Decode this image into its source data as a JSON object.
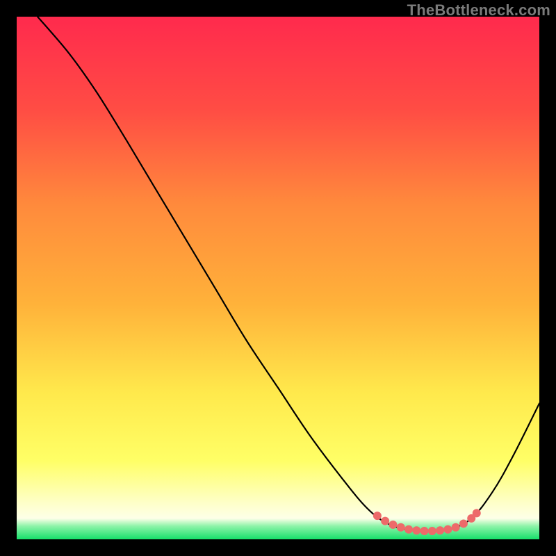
{
  "watermark": "TheBottleneck.com",
  "colors": {
    "frame_bg": "#000000",
    "watermark": "#7a7a7a",
    "curve": "#000000",
    "marker": "#ed6a6a",
    "grad_top": "#ff2a4d",
    "grad_mid1": "#ff6a3c",
    "grad_mid2": "#ffb23a",
    "grad_mid3": "#ffe34a",
    "grad_mid4": "#ffff66",
    "grad_bottom_yellow": "#fdffd0",
    "grad_bottom_green": "#16e06a"
  },
  "chart_data": {
    "type": "line",
    "title": "",
    "xlabel": "",
    "ylabel": "",
    "xlim": [
      0,
      100
    ],
    "ylim": [
      0,
      100
    ],
    "grid": false,
    "curve": [
      {
        "x": 4,
        "y": 100
      },
      {
        "x": 10,
        "y": 93
      },
      {
        "x": 15,
        "y": 86
      },
      {
        "x": 20,
        "y": 78
      },
      {
        "x": 26,
        "y": 68
      },
      {
        "x": 32,
        "y": 58
      },
      {
        "x": 38,
        "y": 48
      },
      {
        "x": 44,
        "y": 38
      },
      {
        "x": 50,
        "y": 29
      },
      {
        "x": 56,
        "y": 20
      },
      {
        "x": 62,
        "y": 12
      },
      {
        "x": 67,
        "y": 6
      },
      {
        "x": 71,
        "y": 3
      },
      {
        "x": 75,
        "y": 1.8
      },
      {
        "x": 79,
        "y": 1.6
      },
      {
        "x": 83,
        "y": 2.0
      },
      {
        "x": 87,
        "y": 4
      },
      {
        "x": 91,
        "y": 9
      },
      {
        "x": 95,
        "y": 16
      },
      {
        "x": 100,
        "y": 26
      }
    ],
    "markers": [
      {
        "x": 69,
        "y": 4.5
      },
      {
        "x": 70.5,
        "y": 3.5
      },
      {
        "x": 72,
        "y": 2.8
      },
      {
        "x": 73.5,
        "y": 2.3
      },
      {
        "x": 75,
        "y": 1.9
      },
      {
        "x": 76.5,
        "y": 1.7
      },
      {
        "x": 78,
        "y": 1.6
      },
      {
        "x": 79.5,
        "y": 1.6
      },
      {
        "x": 81,
        "y": 1.7
      },
      {
        "x": 82.5,
        "y": 1.9
      },
      {
        "x": 84,
        "y": 2.3
      },
      {
        "x": 85.5,
        "y": 3.0
      },
      {
        "x": 87,
        "y": 4.0
      },
      {
        "x": 88,
        "y": 5.0
      }
    ]
  }
}
